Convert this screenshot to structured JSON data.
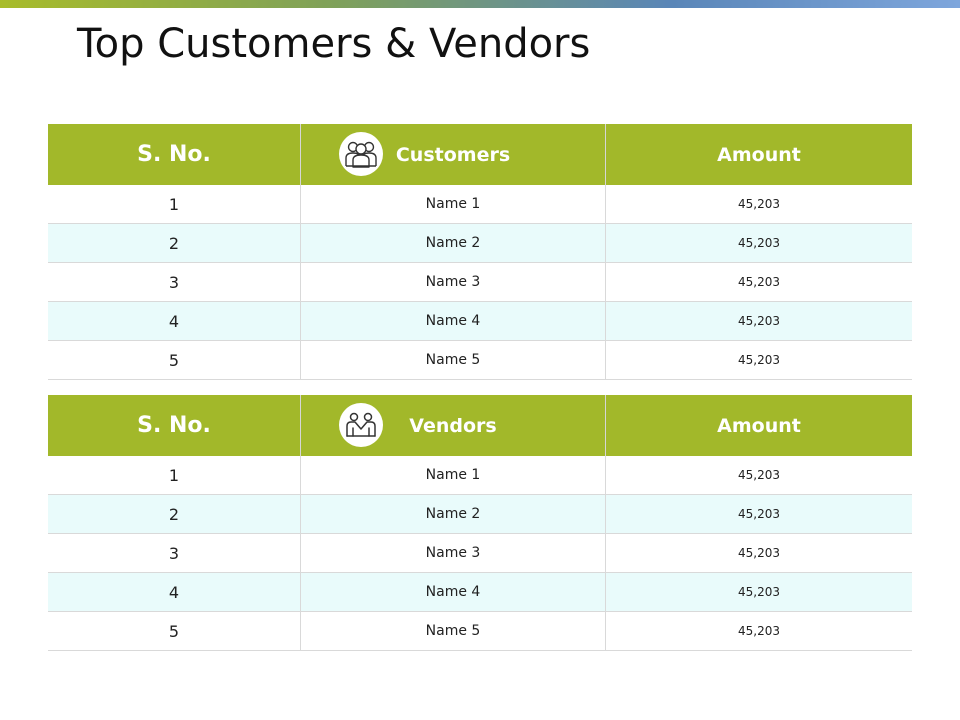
{
  "title": "Top Customers & Vendors",
  "colors": {
    "header_green": "#a2b82a",
    "row_alt": "#e9fbfb"
  },
  "customers_table": {
    "headers": {
      "sno": "S. No.",
      "name": "Customers",
      "amount": "Amount"
    },
    "icon": "people-group-icon",
    "rows": [
      {
        "sno": "1",
        "name": "Name 1",
        "amount": "45,203"
      },
      {
        "sno": "2",
        "name": "Name 2",
        "amount": "45,203"
      },
      {
        "sno": "3",
        "name": "Name 3",
        "amount": "45,203"
      },
      {
        "sno": "4",
        "name": "Name 4",
        "amount": "45,203"
      },
      {
        "sno": "5",
        "name": "Name 5",
        "amount": "45,203"
      }
    ]
  },
  "vendors_table": {
    "headers": {
      "sno": "S. No.",
      "name": "Vendors",
      "amount": "Amount"
    },
    "icon": "handshake-icon",
    "rows": [
      {
        "sno": "1",
        "name": "Name 1",
        "amount": "45,203"
      },
      {
        "sno": "2",
        "name": "Name 2",
        "amount": "45,203"
      },
      {
        "sno": "3",
        "name": "Name 3",
        "amount": "45,203"
      },
      {
        "sno": "4",
        "name": "Name 4",
        "amount": "45,203"
      },
      {
        "sno": "5",
        "name": "Name 5",
        "amount": "45,203"
      }
    ]
  }
}
